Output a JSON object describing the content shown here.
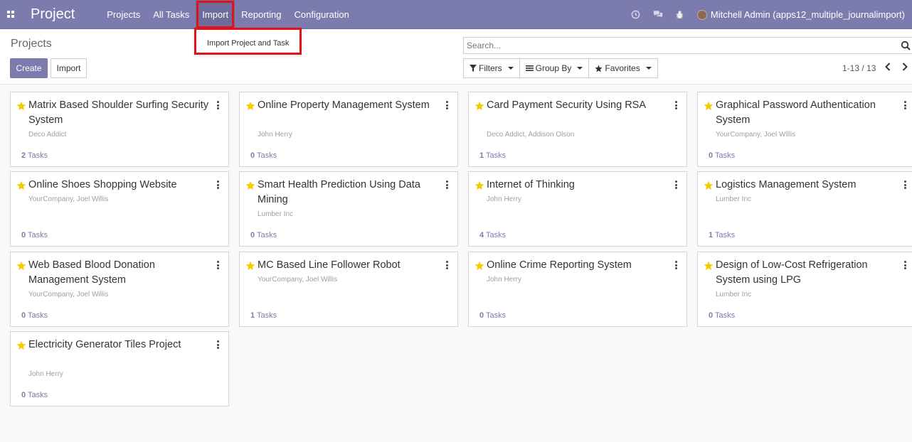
{
  "navbar": {
    "app_title": "Project",
    "menu": [
      "Projects",
      "All Tasks",
      "Import",
      "Reporting",
      "Configuration"
    ],
    "active_menu": "Import",
    "user_label": "Mitchell Admin (apps12_multiple_journalimport)",
    "icons": [
      "apps-grid-icon",
      "clock-icon",
      "chat-icon",
      "bug-icon"
    ]
  },
  "dropdown": {
    "items": [
      "Import Project and Task"
    ]
  },
  "control_panel": {
    "breadcrumb": "Projects",
    "create_label": "Create",
    "import_label": "Import",
    "search_placeholder": "Search...",
    "filters_label": "Filters",
    "groupby_label": "Group By",
    "favorites_label": "Favorites",
    "pager": "1-13 / 13"
  },
  "projects": [
    {
      "name": "Matrix Based Shoulder Surfing Security System",
      "partner": "Deco Addict",
      "task_count": "2",
      "task_label": "Tasks"
    },
    {
      "name": "Online Property Management System",
      "partner": "John Herry",
      "task_count": "0",
      "task_label": "Tasks"
    },
    {
      "name": "Card Payment Security Using RSA",
      "partner": "Deco Addict, Addison Olson",
      "task_count": "1",
      "task_label": "Tasks"
    },
    {
      "name": "Graphical Password Authentication System",
      "partner": "YourCompany, Joel Willis",
      "task_count": "0",
      "task_label": "Tasks"
    },
    {
      "name": "Online Shoes Shopping Website",
      "partner": "YourCompany, Joel Willis",
      "task_count": "0",
      "task_label": "Tasks"
    },
    {
      "name": "Smart Health Prediction Using Data Mining",
      "partner": "Lumber Inc",
      "task_count": "0",
      "task_label": "Tasks"
    },
    {
      "name": "Internet of Thinking",
      "partner": "John Herry",
      "task_count": "4",
      "task_label": "Tasks"
    },
    {
      "name": "Logistics Management System",
      "partner": "Lumber Inc",
      "task_count": "1",
      "task_label": "Tasks"
    },
    {
      "name": "Web Based Blood Donation Management System",
      "partner": "YourCompany, Joel Willis",
      "task_count": "0",
      "task_label": "Tasks"
    },
    {
      "name": "MC Based Line Follower Robot",
      "partner": "YourCompany, Joel Willis",
      "task_count": "1",
      "task_label": "Tasks"
    },
    {
      "name": "Online Crime Reporting System",
      "partner": "John Herry",
      "task_count": "0",
      "task_label": "Tasks"
    },
    {
      "name": "Design of Low-Cost Refrigeration System using LPG",
      "partner": "Lumber Inc",
      "task_count": "0",
      "task_label": "Tasks"
    },
    {
      "name": "Electricity Generator Tiles Project",
      "partner": "John Herry",
      "task_count": "0",
      "task_label": "Tasks"
    }
  ],
  "colors": {
    "brand": "#7c7bad",
    "star": "#f3cc00",
    "highlight": "#e0131a"
  }
}
